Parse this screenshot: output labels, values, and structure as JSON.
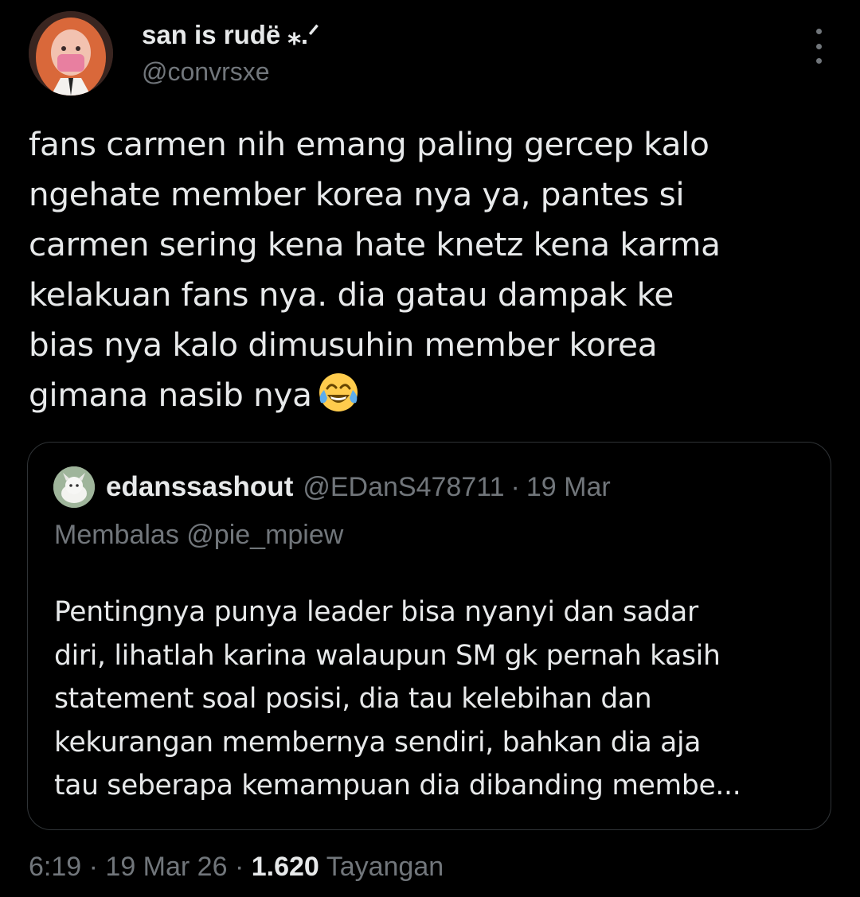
{
  "author": {
    "display_name": "san is rudë ⁎.ᐟ",
    "handle": "@convrsxe"
  },
  "tweet": {
    "text": "fans carmen nih emang paling gercep kalo\nngehate member korea nya ya, pantes si\ncarmen sering kena hate knetz kena karma\nkelakuan fans nya. dia gatau dampak ke\nbias nya kalo dimusuhin member korea\ngimana nasib nya",
    "emoji": "face-with-tears-of-joy"
  },
  "quoted_tweet": {
    "display_name": "edanssashout",
    "handle": "@EDanS478711",
    "separator": "·",
    "date": "19 Mar",
    "reply_to": "Membalas @pie_mpiew",
    "text": "Pentingnya punya leader bisa nyanyi dan sadar\ndiri, lihatlah karina walaupun SM gk pernah kasih\nstatement soal posisi, dia tau kelebihan dan\nkekurangan membernya sendiri, bahkan dia aja\ntau seberapa kemampuan dia dibanding membe..."
  },
  "meta": {
    "time": "6:19",
    "sep1": "·",
    "date": "19 Mar 26",
    "sep2": "·",
    "views_count": "1.620",
    "views_label": "Tayangan"
  },
  "colors": {
    "background": "#000000",
    "primary_text": "#e7e9ea",
    "secondary_text": "#71767b",
    "border": "#2f3336"
  }
}
